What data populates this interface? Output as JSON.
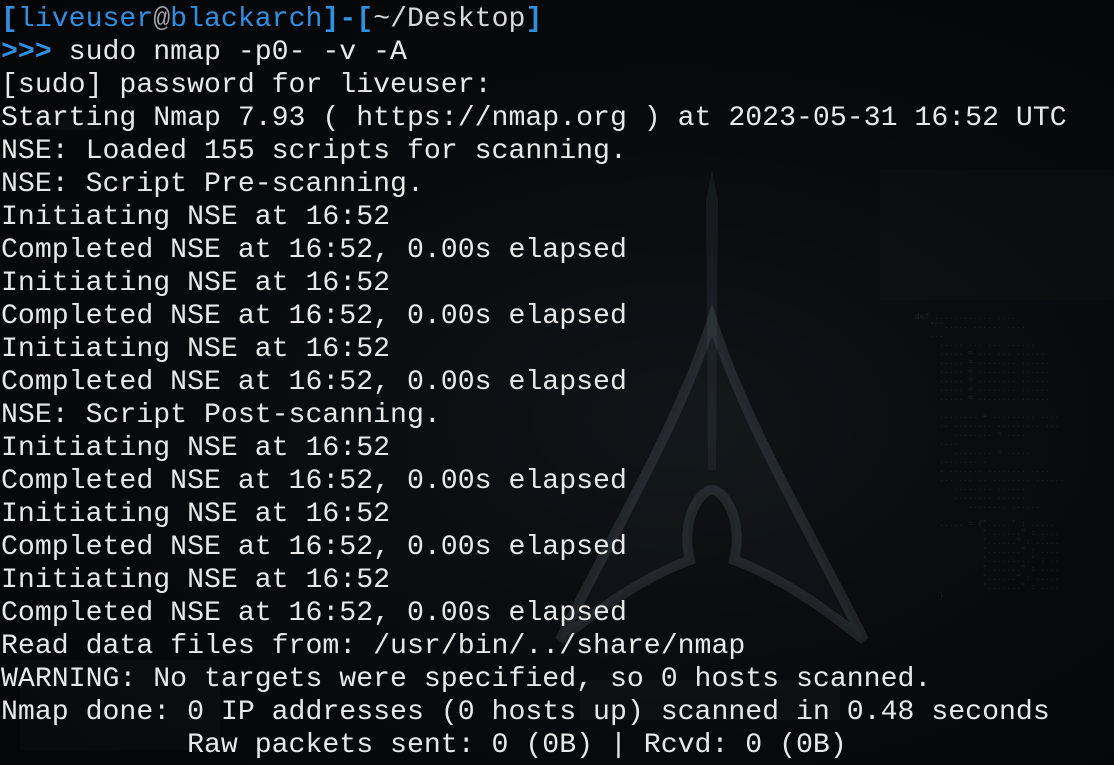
{
  "prompt": {
    "open_bracket": "[",
    "user": "liveuser",
    "at": "@",
    "host": "blackarch",
    "close_bracket": "]",
    "separator": "-",
    "dir_open": "[",
    "dir": "~/Desktop",
    "dir_close": "]",
    "arrows": ">>>",
    "command": " sudo nmap -p0- -v -A"
  },
  "output_lines": [
    "[sudo] password for liveuser:",
    "Starting Nmap 7.93 ( https://nmap.org ) at 2023-05-31 16:52 UTC",
    "NSE: Loaded 155 scripts for scanning.",
    "NSE: Script Pre-scanning.",
    "Initiating NSE at 16:52",
    "Completed NSE at 16:52, 0.00s elapsed",
    "Initiating NSE at 16:52",
    "Completed NSE at 16:52, 0.00s elapsed",
    "Initiating NSE at 16:52",
    "Completed NSE at 16:52, 0.00s elapsed",
    "NSE: Script Post-scanning.",
    "Initiating NSE at 16:52",
    "Completed NSE at 16:52, 0.00s elapsed",
    "Initiating NSE at 16:52",
    "Completed NSE at 16:52, 0.00s elapsed",
    "Initiating NSE at 16:52",
    "Completed NSE at 16:52, 0.00s elapsed",
    "Read data files from: /usr/bin/../share/nmap",
    "WARNING: No targets were specified, so 0 hosts scanned.",
    "Nmap done: 0 IP addresses (0 hosts up) scanned in 0.48 seconds",
    "           Raw packets sent: 0 (0B) | Rcvd: 0 (0B)"
  ],
  "colors": {
    "prompt_accent": "#2f8fe0",
    "text": "#e8e8e8",
    "background": "#050608"
  }
}
